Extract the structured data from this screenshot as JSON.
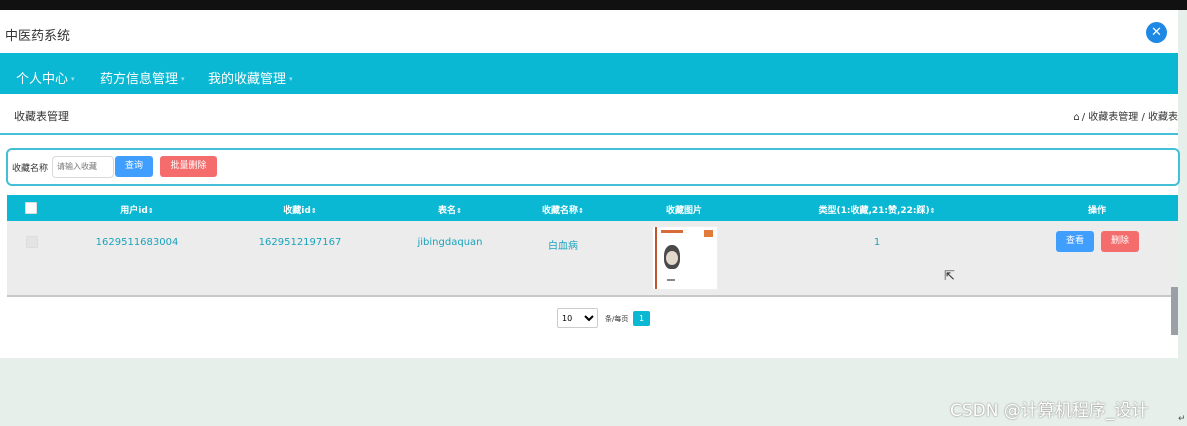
{
  "app": {
    "title": "中医药系统",
    "fullscreen_icon": "fullscreen-icon"
  },
  "nav": {
    "items": [
      {
        "label": "个人中心"
      },
      {
        "label": "药方信息管理"
      },
      {
        "label": "我的收藏管理"
      }
    ],
    "caret": "▾"
  },
  "page": {
    "title": "收藏表管理",
    "breadcrumb": "/ 收藏表管理 / 收藏表",
    "home_icon": "home-icon"
  },
  "search": {
    "label": "收藏名称",
    "placeholder": "请输入收藏",
    "query_button": "查询",
    "batch_delete_button": "批量删除"
  },
  "table": {
    "headers": [
      "用户id",
      "收藏id",
      "表名",
      "收藏名称",
      "收藏图片",
      "类型(1:收藏,21:赞,22:踩)",
      "操作"
    ],
    "sort_icon": "⇕",
    "rows": [
      {
        "user_id": "1629511683004",
        "favorite_id": "1629512197167",
        "table_name": "jibingdaquan",
        "favorite_name": "白血病",
        "image": "book-cover-thumbnail",
        "type": "1",
        "view_button": "查看",
        "delete_button": "删除"
      }
    ]
  },
  "pagination": {
    "page_size": "10",
    "page_size_options": [
      "10"
    ],
    "per_page_text": "条/每页",
    "current_page": "1"
  },
  "watermark": "CSDN @计算机程序_设计",
  "colors": {
    "accent": "#0bb8d3",
    "primary_button": "#409eff",
    "danger_button": "#f56c6c",
    "page_bg": "#e6efe9"
  }
}
